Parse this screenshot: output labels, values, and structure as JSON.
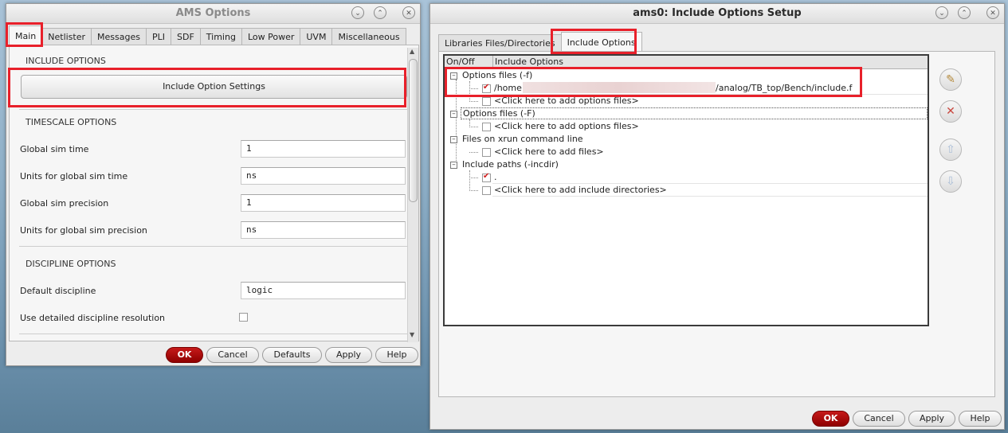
{
  "ams_window": {
    "title": "AMS Options",
    "tabs": [
      "Main",
      "Netlister",
      "Messages",
      "PLI",
      "SDF",
      "Timing",
      "Low Power",
      "UVM",
      "Miscellaneous"
    ],
    "active_tab": "Main",
    "include_section": "INCLUDE OPTIONS",
    "include_button": "Include Option Settings",
    "timescale_section": "TIMESCALE OPTIONS",
    "fields": [
      {
        "label": "Global sim time",
        "value": "1"
      },
      {
        "label": "Units for global sim time",
        "value": "ns"
      },
      {
        "label": "Global sim precision",
        "value": "1"
      },
      {
        "label": "Units for global sim precision",
        "value": "ns"
      }
    ],
    "discipline_section": "DISCIPLINE OPTIONS",
    "default_discipline_label": "Default discipline",
    "default_discipline_value": "logic",
    "detailed_resolution_label": "Use detailed discipline resolution",
    "detailed_resolution_checked": false,
    "buttons": {
      "ok": "OK",
      "cancel": "Cancel",
      "defaults": "Defaults",
      "apply": "Apply",
      "help": "Help"
    }
  },
  "include_window": {
    "title": "ams0: Include Options Setup",
    "tabs": [
      "Libraries Files/Directories",
      "Include Options"
    ],
    "active_tab": "Include Options",
    "columns": {
      "on_off": "On/Off",
      "include_options": "Include Options"
    },
    "groups": [
      {
        "label": "Options files (-f)",
        "items": [
          {
            "checked": true,
            "text_start": "/home",
            "text_end": "/analog/TB_top/Bench/include.f"
          },
          {
            "checked": false,
            "text": "<Click here to add options files>"
          }
        ]
      },
      {
        "label": "Options files (-F)",
        "items": [
          {
            "checked": false,
            "text": "<Click here to add options files>"
          }
        ]
      },
      {
        "label": "Files on xrun command line",
        "items": [
          {
            "checked": false,
            "text": "<Click here to add files>"
          }
        ]
      },
      {
        "label": "Include paths (-incdir)",
        "items": [
          {
            "checked": true,
            "text": "."
          },
          {
            "checked": false,
            "text": "<Click here to add include directories>"
          }
        ]
      }
    ],
    "side_icons": [
      "edit-icon",
      "delete-icon",
      "move-up-icon",
      "move-down-icon"
    ],
    "buttons": {
      "ok": "OK",
      "cancel": "Cancel",
      "apply": "Apply",
      "help": "Help"
    }
  },
  "colors": {
    "highlight": "#e8202a",
    "ok_button": "#b00d0d",
    "check": "#d01c1c"
  }
}
